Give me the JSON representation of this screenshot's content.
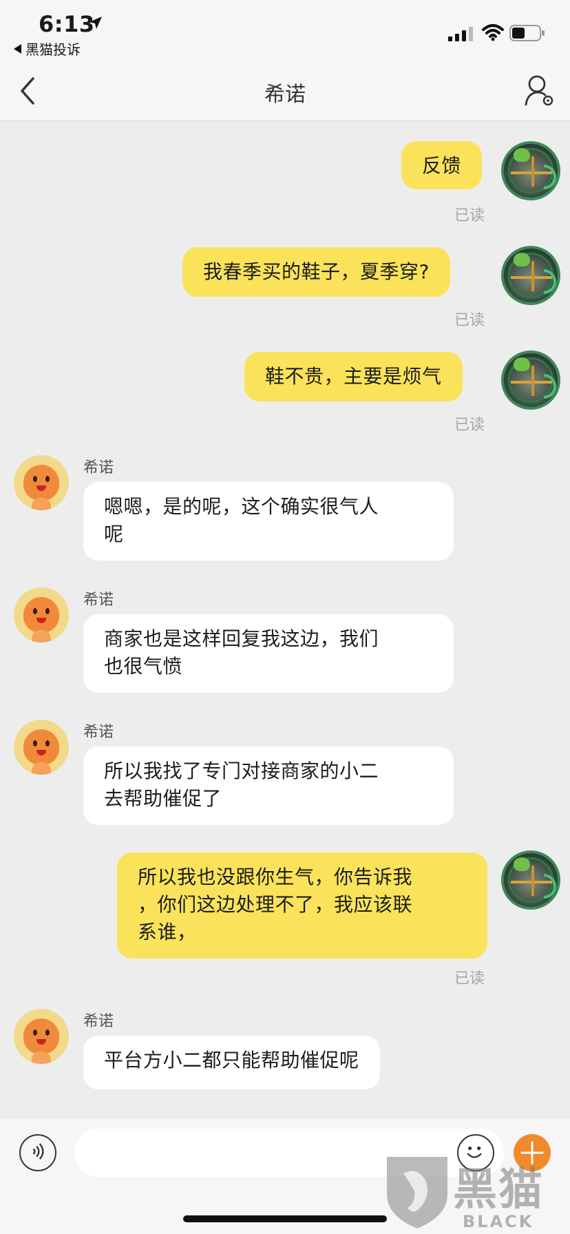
{
  "status_bar": {
    "time": "6:13",
    "back_app_label": "黑猫投诉",
    "icons": [
      "location-arrow-icon",
      "cellular-signal-icon",
      "wifi-icon",
      "battery-icon"
    ]
  },
  "nav": {
    "title": "希诺",
    "icons": [
      "back-chevron-icon",
      "user-settings-icon"
    ]
  },
  "messages": [
    {
      "direction": "out",
      "text": "反馈",
      "status": "已读"
    },
    {
      "direction": "out",
      "text": "我春季买的鞋子，夏季穿?",
      "status": "已读"
    },
    {
      "direction": "out",
      "text": "鞋不贵，主要是烦气",
      "status": "已读"
    },
    {
      "direction": "in",
      "sender": "希诺",
      "lines": [
        "嗯嗯，是的呢，这个确实很气人",
        "呢"
      ]
    },
    {
      "direction": "in",
      "sender": "希诺",
      "lines": [
        "商家也是这样回复我这边，我们",
        "也很气愤"
      ]
    },
    {
      "direction": "in",
      "sender": "希诺",
      "lines": [
        "所以我找了专门对接商家的小二",
        "去帮助催促了"
      ]
    },
    {
      "direction": "out",
      "lines": [
        "所以我也没跟你生气，你告诉我",
        "，你们这边处理不了，我应该联",
        "系谁，"
      ],
      "status": "已读"
    },
    {
      "direction": "in",
      "sender": "希诺",
      "lines": [
        "平台方小二都只能帮助催促呢"
      ]
    }
  ],
  "input_bar": {
    "placeholder": "",
    "icons": [
      "voice-icon",
      "emoji-icon",
      "plus-icon"
    ]
  },
  "watermark": {
    "text": "黑猫",
    "sub": "BLACK CAT"
  },
  "colors": {
    "outgoing_bubble": "#fae35a",
    "incoming_bubble": "#ffffff",
    "chat_background": "#ededed",
    "accent": "#f08a2a"
  }
}
